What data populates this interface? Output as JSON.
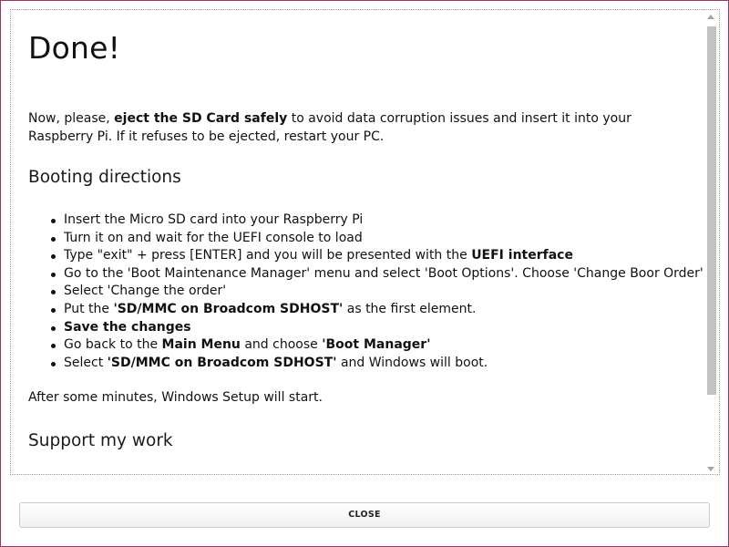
{
  "title": "Done!",
  "intro": {
    "part1": "Now, please, ",
    "bold": "eject the SD Card safely",
    "part2": " to avoid data corruption issues and insert it into your Raspberry Pi. If it refuses to be ejected, restart your PC."
  },
  "booting_heading": "Booting directions",
  "directions": [
    {
      "pre": "Insert the Micro SD card into your Raspberry Pi",
      "bold": "",
      "post": ""
    },
    {
      "pre": "Turn it on and wait for the UEFI console to load",
      "bold": "",
      "post": ""
    },
    {
      "pre": "Type \"exit\" + press [ENTER] and you will be presented with the ",
      "bold": "UEFI interface",
      "post": ""
    },
    {
      "pre": "Go to the 'Boot Maintenance Manager' menu and select 'Boot Options'. Choose 'Change Boor Order'",
      "bold": "",
      "post": ""
    },
    {
      "pre": "Select 'Change the order'",
      "bold": "",
      "post": ""
    },
    {
      "pre": "Put the ",
      "bold": "'SD/MMC on Broadcom SDHOST'",
      "post": " as the first element."
    },
    {
      "pre": "",
      "bold": "Save the changes",
      "post": ""
    },
    {
      "pre": "Go back to the ",
      "bold": "Main Menu",
      "post": " and choose ",
      "bold2": "'Boot Manager'"
    },
    {
      "pre": "Select ",
      "bold": "'SD/MMC on Broadcom SDHOST'",
      "post": " and Windows will boot."
    }
  ],
  "after_text": "After some minutes, Windows Setup will start.",
  "support_heading": "Support my work",
  "close_label": "CLOSE",
  "colors": {
    "frame_border": "#a0306a",
    "scroll_thumb": "#c2c2c2"
  }
}
